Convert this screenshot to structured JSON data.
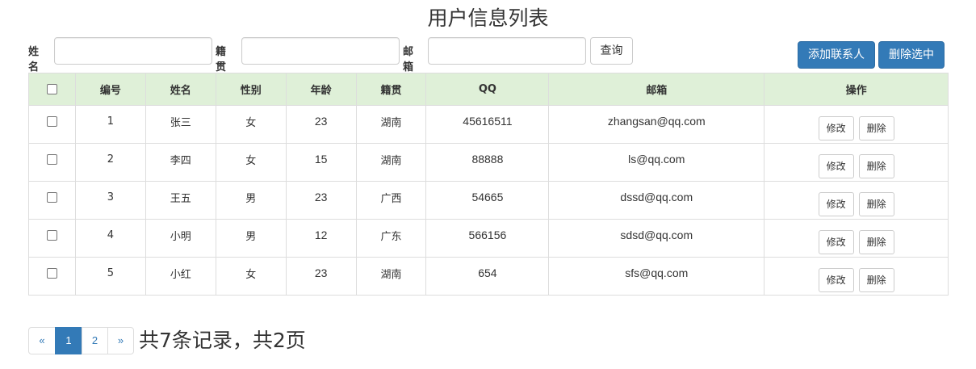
{
  "title": "用户信息列表",
  "search": {
    "name_label": "姓名",
    "name_value": "",
    "hometown_label": "籍贯",
    "hometown_value": "",
    "email_label": "邮箱",
    "email_value": "",
    "query_button": "查询"
  },
  "toolbar": {
    "add_button": "添加联系人",
    "delete_selected_button": "删除选中"
  },
  "table": {
    "columns": [
      "编号",
      "姓名",
      "性别",
      "年龄",
      "籍贯",
      "QQ",
      "邮箱",
      "操作"
    ],
    "rows": [
      {
        "id": "1",
        "name": "张三",
        "gender": "女",
        "age": "23",
        "hometown": "湖南",
        "qq": "45616511",
        "email": "zhangsan@qq.com"
      },
      {
        "id": "2",
        "name": "李四",
        "gender": "女",
        "age": "15",
        "hometown": "湖南",
        "qq": "88888",
        "email": "ls@qq.com"
      },
      {
        "id": "3",
        "name": "王五",
        "gender": "男",
        "age": "23",
        "hometown": "广西",
        "qq": "54665",
        "email": "dssd@qq.com"
      },
      {
        "id": "4",
        "name": "小明",
        "gender": "男",
        "age": "12",
        "hometown": "广东",
        "qq": "566156",
        "email": "sdsd@qq.com"
      },
      {
        "id": "5",
        "name": "小红",
        "gender": "女",
        "age": "23",
        "hometown": "湖南",
        "qq": "654",
        "email": "sfs@qq.com"
      }
    ],
    "edit_label": "修改",
    "delete_label": "删除"
  },
  "pagination": {
    "prev": "«",
    "pages": [
      "1",
      "2"
    ],
    "active_page": "1",
    "next": "»",
    "summary": "共7条记录，共2页"
  },
  "colors": {
    "primary": "#337ab7",
    "header_bg": "#dff0d8",
    "border": "#dddddd"
  }
}
